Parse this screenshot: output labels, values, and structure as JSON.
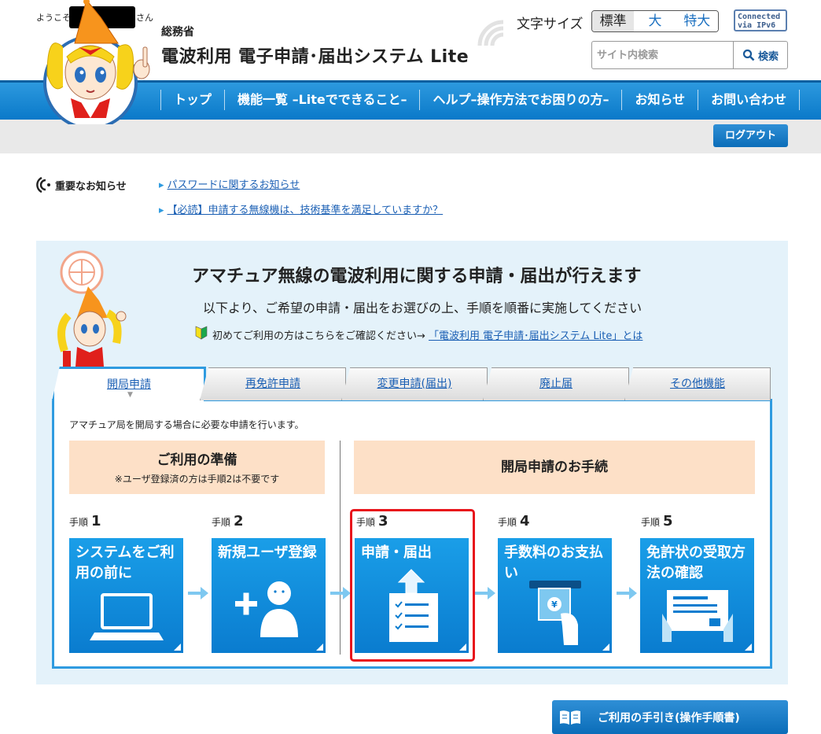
{
  "header": {
    "ministry": "総務省",
    "title": "電波利用 電子申請･届出システム Lite",
    "font_size_label": "文字サイズ",
    "font_sizes": [
      "標準",
      "大",
      "特大"
    ],
    "font_size_selected": "標準",
    "ipv6_line1": "Connected",
    "ipv6_line2": "via IPv6",
    "search_placeholder": "サイト内検索",
    "search_button": "検索"
  },
  "nav": {
    "items": [
      "トップ",
      "機能一覧 –Liteでできること–",
      "ヘルプ–操作方法でお困りの方–",
      "お知らせ",
      "お問い合わせ"
    ]
  },
  "welcome": {
    "prefix": "ようこそ",
    "suffix": "さん",
    "logout": "ログアウト"
  },
  "notices": {
    "heading": "重要なお知らせ",
    "links": [
      "パスワードに関するお知らせ",
      "【必読】申請する無線機は、技術基準を満足していますか？"
    ]
  },
  "main": {
    "title": "アマチュア無線の電波利用に関する申請・届出が行えます",
    "subtitle": "以下より、ご希望の申請・届出をお選びの上、手順を順番に実施してください",
    "first_time_text": "初めてご利用の方はこちらをご確認ください→",
    "first_time_link": "「電波利用 電子申請･届出システム Lite」とは",
    "tabs": [
      "開局申請",
      "再免許申請",
      "変更申請(届出)",
      "廃止届",
      "その他機能"
    ],
    "active_tab": "開局申請",
    "tab_description": "アマチュア局を開局する場合に必要な申請を行います。",
    "prep_title": "ご利用の準備",
    "prep_note": "※ユーザ登録済の方は手順2は不要です",
    "procedure_title": "開局申請のお手続",
    "step_prefix": "手順",
    "steps": [
      {
        "number": "1",
        "label": "システムをご利用の前に"
      },
      {
        "number": "2",
        "label": "新規ユーザ登録"
      },
      {
        "number": "3",
        "label": "申請・届出"
      },
      {
        "number": "4",
        "label": "手数料のお支払い"
      },
      {
        "number": "5",
        "label": "免許状の受取方法の確認"
      }
    ],
    "highlighted_step": "3"
  },
  "guide_button": "ご利用の手引き(操作手順書)",
  "colors": {
    "primary_blue": "#0a7ccf",
    "panel_bg": "#e4f2fa",
    "peach": "#fde0c7",
    "highlight_red": "#e8131b"
  }
}
